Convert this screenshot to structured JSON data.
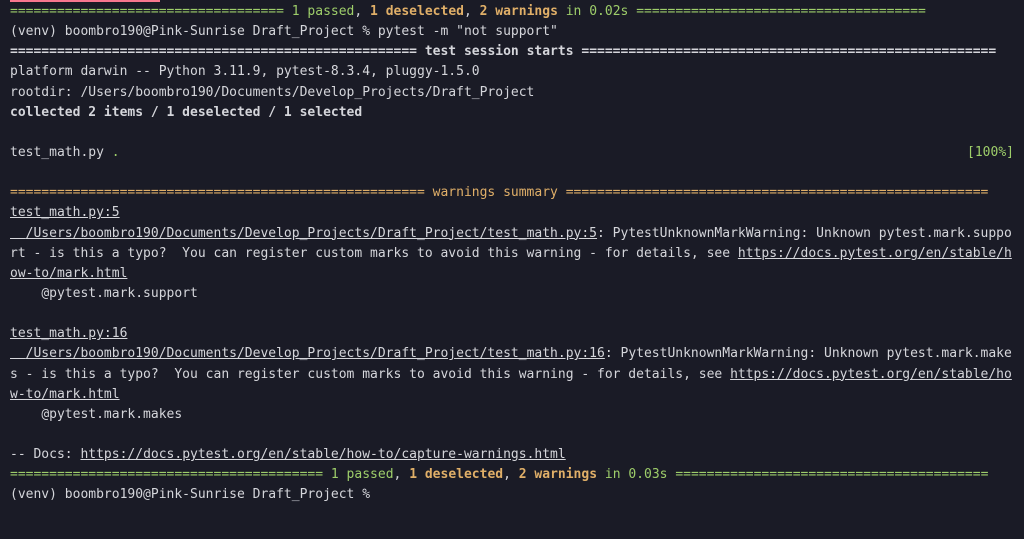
{
  "summary1": {
    "prefix": "===================================",
    "passed": " 1 passed",
    "comma1": ", ",
    "deselected": "1 deselected",
    "comma2": ", ",
    "warnings": "2 warnings",
    "time": " in 0.02s ",
    "suffix": "====================================="
  },
  "prompt1": "(venv) boombro190@Pink-Sunrise Draft_Project % pytest -m \"not support\"",
  "session": {
    "prefix": "==================================================== ",
    "label": "test session starts",
    "suffix": " ====================================================="
  },
  "platform": "platform darwin -- Python 3.11.9, pytest-8.3.4, pluggy-1.5.0",
  "rootdir": "rootdir: /Users/boombro190/Documents/Develop_Projects/Draft_Project",
  "collected": "collected 2 items / 1 deselected / 1 selected",
  "testfile": "test_math.py ",
  "dot": ".",
  "percent": "[100%]",
  "warnings_header": {
    "prefix": "===================================================== ",
    "label": "warnings summary",
    "suffix": " ======================================================"
  },
  "w1": {
    "loc": "test_math.py:5",
    "path": "  /Users/boombro190/Documents/Develop_Projects/Draft_Project/test_math.py:5",
    "msg": ": PytestUnknownMarkWarning: Unknown pytest.mark.support - is this a typo?  You can register custom marks to avoid this warning - for details, see ",
    "url": "https://docs.pytest.org/en/stable/how-to/mark.html",
    "code": "    @pytest.mark.support"
  },
  "w2": {
    "loc": "test_math.py:16",
    "path": "  /Users/boombro190/Documents/Develop_Projects/Draft_Project/test_math.py:16",
    "msg": ": PytestUnknownMarkWarning: Unknown pytest.mark.makes - is this a typo?  You can register custom marks to avoid this warning - for details, see ",
    "url": "https://docs.pytest.org/en/stable/how-to/mark.html",
    "code": "    @pytest.mark.makes"
  },
  "docs": {
    "prefix": "-- Docs: ",
    "url": "https://docs.pytest.org/en/stable/how-to/capture-warnings.html"
  },
  "summary2": {
    "prefix": "======================================== ",
    "passed": "1 passed",
    "comma1": ", ",
    "deselected": "1 deselected",
    "comma2": ", ",
    "warnings": "2 warnings",
    "time": " in 0.03s ",
    "suffix": "========================================"
  },
  "prompt2": "(venv) boombro190@Pink-Sunrise Draft_Project % "
}
